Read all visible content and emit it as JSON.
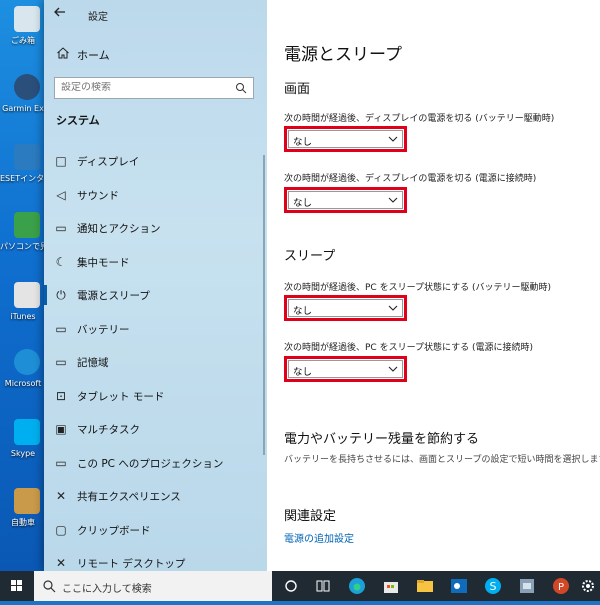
{
  "desktop": {
    "icons": [
      {
        "label": "ごみ箱",
        "color": "#d9e6ee"
      },
      {
        "label": "Garmin Ex",
        "color": "#2a4f7a"
      },
      {
        "label": "ESETインタ ーネットセキ",
        "color": "#2a7bc0"
      },
      {
        "label": "パソコンで見 アル",
        "color": "#3aa04a"
      },
      {
        "label": "iTunes",
        "color": "#e4e4e4"
      },
      {
        "label": "Microsoft",
        "color": "#1e8fd6"
      },
      {
        "label": "Skype",
        "color": "#00aff0"
      },
      {
        "label": "自動車",
        "color": "#c99a4a"
      }
    ]
  },
  "window": {
    "title": "設定",
    "back_icon": "back-arrow-icon"
  },
  "sidebar": {
    "home_label": "ホーム",
    "search_placeholder": "設定の検索",
    "section": "システム",
    "items": [
      {
        "label": "ディスプレイ",
        "icon": "□"
      },
      {
        "label": "サウンド",
        "icon": "◁"
      },
      {
        "label": "通知とアクション",
        "icon": "▭"
      },
      {
        "label": "集中モード",
        "icon": "☾"
      },
      {
        "label": "電源とスリープ",
        "icon": "⏻"
      },
      {
        "label": "バッテリー",
        "icon": "▭"
      },
      {
        "label": "記憶域",
        "icon": "▭"
      },
      {
        "label": "タブレット モード",
        "icon": "⊡"
      },
      {
        "label": "マルチタスク",
        "icon": "▣"
      },
      {
        "label": "この PC へのプロジェクション",
        "icon": "▭"
      },
      {
        "label": "共有エクスペリエンス",
        "icon": "✕"
      },
      {
        "label": "クリップボード",
        "icon": "▢"
      },
      {
        "label": "リモート デスクトップ",
        "icon": "✕"
      }
    ]
  },
  "content": {
    "title": "電源とスリープ",
    "screen_heading": "画面",
    "screen_battery_desc": "次の時間が経過後、ディスプレイの電源を切る (バッテリー駆動時)",
    "screen_battery_value": "なし",
    "screen_plugged_desc": "次の時間が経過後、ディスプレイの電源を切る (電源に接続時)",
    "screen_plugged_value": "なし",
    "sleep_heading": "スリープ",
    "sleep_battery_desc": "次の時間が経過後、PC をスリープ状態にする (バッテリー駆動時)",
    "sleep_battery_value": "なし",
    "sleep_plugged_desc": "次の時間が経過後、PC をスリープ状態にする (電源に接続時)",
    "sleep_plugged_value": "なし",
    "save_heading": "電力やバッテリー残量を節約する",
    "save_note": "バッテリーを長持ちさせるには、画面とスリープの設定で短い時間を選択します。",
    "related_heading": "関連設定",
    "related_link": "電源の追加設定",
    "highlight_color": "#e0001a"
  },
  "taskbar": {
    "search_placeholder": "ここに入力して検索"
  }
}
